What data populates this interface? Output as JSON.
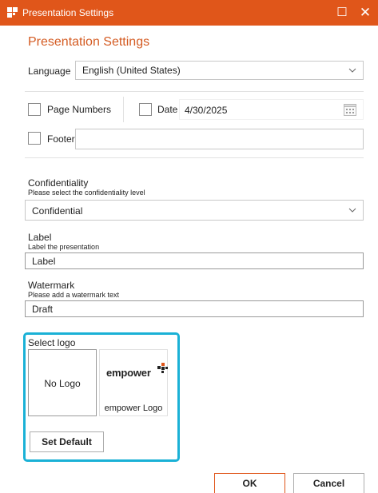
{
  "window": {
    "title": "Presentation Settings",
    "maximize_glyph": "☐",
    "close_glyph": "✕",
    "accent": "#e0561a"
  },
  "heading": "Presentation Settings",
  "language": {
    "label": "Language",
    "value": "English (United States)"
  },
  "options": {
    "page_numbers": {
      "label": "Page Numbers",
      "checked": false
    },
    "date": {
      "label": "Date",
      "checked": false,
      "value": "4/30/2025"
    },
    "footer": {
      "label": "Footer",
      "checked": false,
      "value": ""
    }
  },
  "confidentiality": {
    "title": "Confidentiality",
    "subtitle": "Please select the confidentiality level",
    "value": "Confidential"
  },
  "label_section": {
    "title": "Label",
    "subtitle": "Label the presentation",
    "value": "Label"
  },
  "watermark": {
    "title": "Watermark",
    "subtitle": "Please add a watermark text",
    "value": "Draft"
  },
  "logo": {
    "panel_label": "Select logo",
    "highlight_color": "#1ab1d6",
    "options": [
      {
        "name": "No Logo"
      },
      {
        "brand_text": "empower",
        "name": "empower Logo"
      }
    ],
    "set_default_label": "Set Default"
  },
  "footer_buttons": {
    "ok": "OK",
    "cancel": "Cancel"
  }
}
